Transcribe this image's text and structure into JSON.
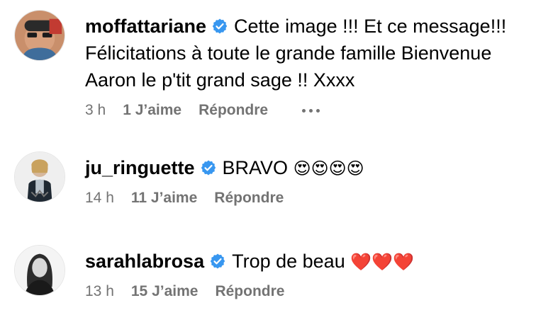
{
  "comments": [
    {
      "username": "moffattariane",
      "text": "Cette image !!! Et ce message!!! Félicitations à toute le grande famille Bienvenue Aaron le p'tit grand sage !! Xxxx",
      "time": "3 h",
      "likes": "1 J’aime",
      "reply": "Répondre",
      "emojis": ""
    },
    {
      "username": "ju_ringuette",
      "text": "BRAVO",
      "time": "14 h",
      "likes": "11 J’aime",
      "reply": "Répondre",
      "emojis": "😍😍😍😍"
    },
    {
      "username": "sarahlabrosa",
      "text": "Trop de beau",
      "time": "13 h",
      "likes": "15 J’aime",
      "reply": "Répondre",
      "emojis": "❤️❤️❤️"
    }
  ],
  "icons": {
    "verified": "verified-badge-icon",
    "more": "more-options-icon"
  },
  "colors": {
    "verified": "#3897f0",
    "secondary_text": "#737373"
  }
}
